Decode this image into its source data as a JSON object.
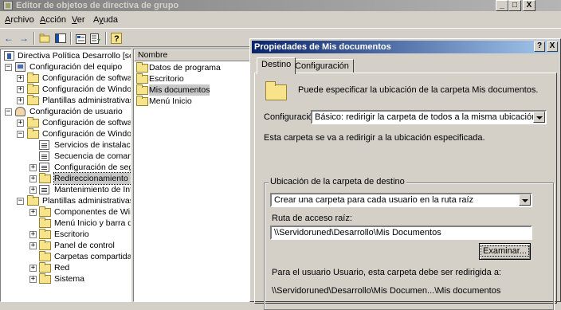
{
  "window": {
    "title": "Editor de objetos de directiva de grupo",
    "minimize": "_",
    "maximize": "□",
    "close": "X"
  },
  "menu": [
    {
      "label": "Archivo",
      "underline": "A",
      "rest": "rchivo"
    },
    {
      "label": "Acción",
      "underline": "A",
      "rest": "cción"
    },
    {
      "label": "Ver",
      "underline": "V",
      "rest": "er"
    },
    {
      "label": "Ayuda",
      "underline": "y",
      "pre": "A",
      "rest": "uda"
    }
  ],
  "toolbar": {
    "back_icon": "arrow-left-icon",
    "forward_icon": "arrow-right-icon",
    "up_icon": "up-folder-icon",
    "show_tree_icon": "show-tree-icon",
    "properties_icon": "properties-icon",
    "export_icon": "export-list-icon",
    "help_icon": "help-icon"
  },
  "tree": {
    "root": "Directiva Política Desarrollo [servido",
    "items": [
      {
        "label": "Configuración del equipo",
        "icon": "computer-icon"
      },
      {
        "label": "Configuración de software",
        "icon": "folder-icon"
      },
      {
        "label": "Configuración de Windows",
        "icon": "folder-icon"
      },
      {
        "label": "Plantillas administrativas",
        "icon": "folder-icon"
      },
      {
        "label": "Configuración de usuario",
        "icon": "user-icon"
      },
      {
        "label": "Configuración de software",
        "icon": "folder-icon"
      },
      {
        "label": "Configuración de Windows",
        "icon": "folder-icon"
      },
      {
        "label": "Servicios de instalación",
        "icon": "document-icon"
      },
      {
        "label": "Secuencia de comandos",
        "icon": "document-icon"
      },
      {
        "label": "Configuración de segur",
        "icon": "security-icon"
      },
      {
        "label": "Redireccionamiento de",
        "icon": "folder-icon"
      },
      {
        "label": "Mantenimiento de Inter",
        "icon": "document-icon"
      },
      {
        "label": "Plantillas administrativas",
        "icon": "folder-icon"
      },
      {
        "label": "Componentes de Windo",
        "icon": "folder-icon"
      },
      {
        "label": "Menú Inicio y barra de",
        "icon": "folder-icon"
      },
      {
        "label": "Escritorio",
        "icon": "folder-icon"
      },
      {
        "label": "Panel de control",
        "icon": "folder-icon"
      },
      {
        "label": "Carpetas compartidas",
        "icon": "folder-icon"
      },
      {
        "label": "Red",
        "icon": "folder-icon"
      },
      {
        "label": "Sistema",
        "icon": "folder-icon"
      }
    ]
  },
  "list": {
    "column": "Nombre",
    "items": [
      "Datos de programa",
      "Escritorio",
      "Mis documentos",
      "Menú Inicio"
    ],
    "selected": "Mis documentos"
  },
  "dialog": {
    "title": "Propiedades de Mis documentos",
    "help": "?",
    "close": "X",
    "tabs": [
      "Destino",
      "Configuración"
    ],
    "description": "Puede especificar la ubicación de la carpeta Mis documentos.",
    "config_label": "Configuración:",
    "config_value": "Básico: redirigir la carpeta de todos a la misma ubicación",
    "redirect_note": "Esta carpeta se va a redirigir a la ubicación especificada.",
    "group_title": "Ubicación de la carpeta de destino",
    "location_value": "Crear una carpeta para cada usuario en la ruta raíz",
    "root_path_label": "Ruta de acceso raíz:",
    "root_path_value": "\\\\Servidoruned\\Desarrollo\\Mis Documentos",
    "browse_button": "Examinar...",
    "example_label": "Para el usuario Usuario, esta carpeta debe ser redirigida a:",
    "example_path": "\\\\Servidoruned\\Desarrollo\\Mis Documen...\\Mis documentos"
  }
}
